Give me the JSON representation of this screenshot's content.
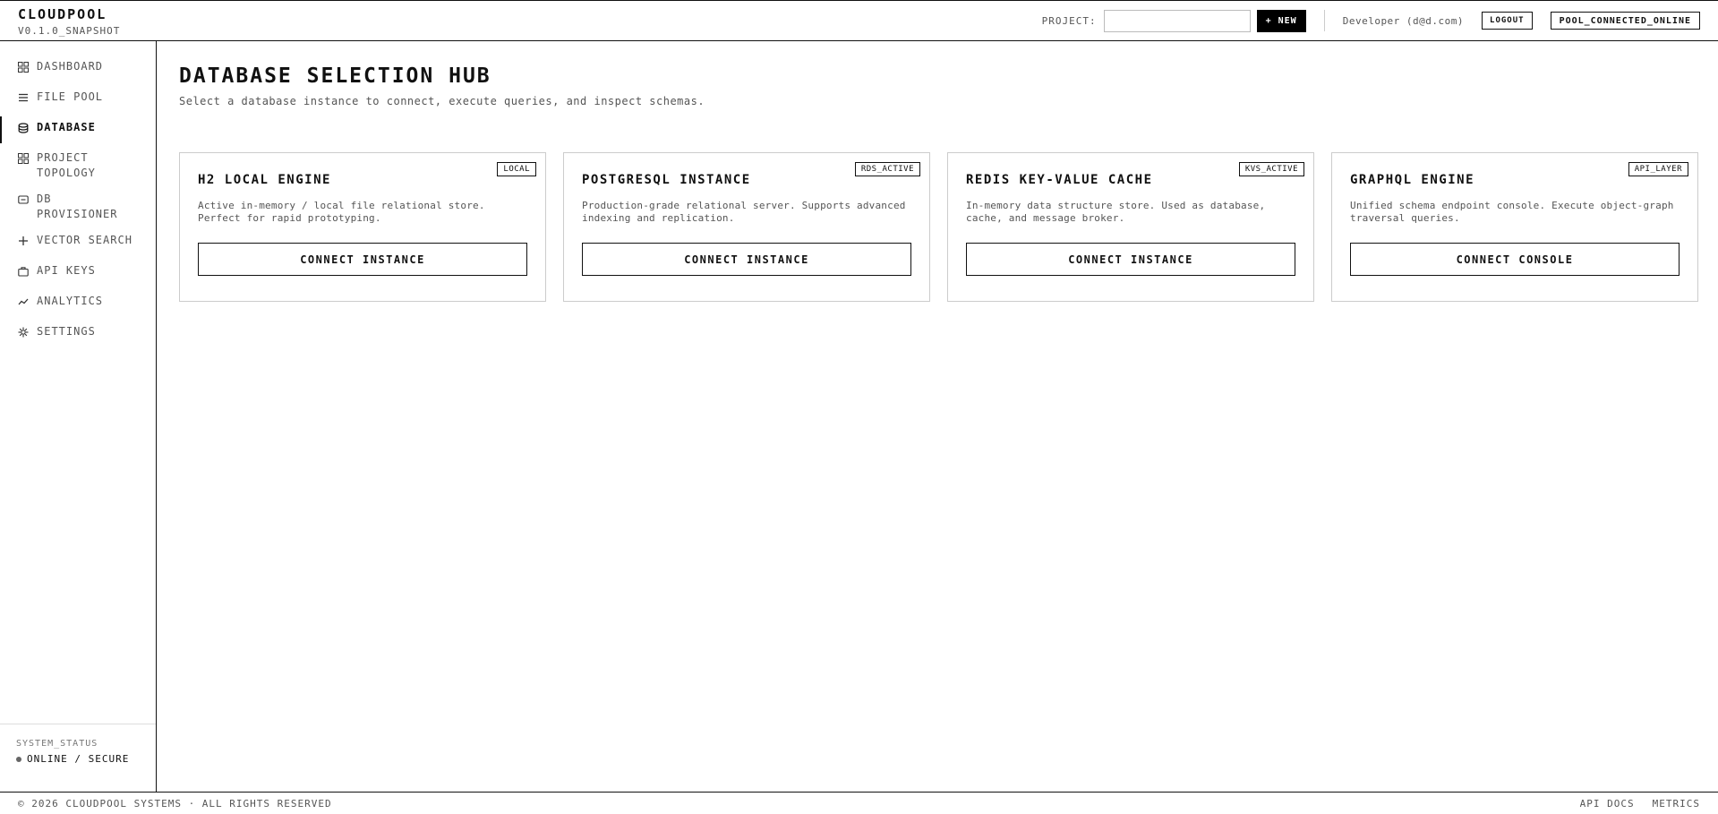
{
  "header": {
    "brand_name": "CLOUDPOOL",
    "brand_version": "V0.1.0_SNAPSHOT",
    "project_label": "PROJECT:",
    "project_value": "",
    "new_button": "+ NEW",
    "user": "Developer (d@d.com)",
    "logout": "LOGOUT",
    "connection_status": "POOL_CONNECTED_ONLINE"
  },
  "sidebar": {
    "items": [
      {
        "label": "DASHBOARD",
        "icon": "grid-icon"
      },
      {
        "label": "FILE POOL",
        "icon": "list-icon"
      },
      {
        "label": "DATABASE",
        "icon": "database-icon",
        "active": true
      },
      {
        "label": "PROJECT TOPOLOGY",
        "icon": "topology-icon"
      },
      {
        "label": "DB PROVISIONER",
        "icon": "server-icon"
      },
      {
        "label": "VECTOR SEARCH",
        "icon": "sparkle-icon"
      },
      {
        "label": "API KEYS",
        "icon": "briefcase-icon"
      },
      {
        "label": "ANALYTICS",
        "icon": "trend-icon"
      },
      {
        "label": "SETTINGS",
        "icon": "gear-icon"
      }
    ],
    "system_status_label": "SYSTEM_STATUS",
    "system_status_value": "ONLINE / SECURE"
  },
  "main": {
    "title": "DATABASE SELECTION HUB",
    "subtitle": "Select a database instance to connect, execute queries, and inspect schemas.",
    "cards": [
      {
        "badge": "LOCAL",
        "title": "H2 LOCAL ENGINE",
        "description": "Active in-memory / local file relational store. Perfect for rapid prototyping.",
        "button": "CONNECT INSTANCE"
      },
      {
        "badge": "RDS_ACTIVE",
        "title": "POSTGRESQL INSTANCE",
        "description": "Production-grade relational server. Supports advanced indexing and replication.",
        "button": "CONNECT INSTANCE"
      },
      {
        "badge": "KVS_ACTIVE",
        "title": "REDIS KEY-VALUE CACHE",
        "description": "In-memory data structure store. Used as database, cache, and message broker.",
        "button": "CONNECT INSTANCE"
      },
      {
        "badge": "API_LAYER",
        "title": "GRAPHQL ENGINE",
        "description": "Unified schema endpoint console. Execute object-graph traversal queries.",
        "button": "CONNECT CONSOLE"
      }
    ]
  },
  "footer": {
    "copyright": "© 2026 CLOUDPOOL SYSTEMS · ALL RIGHTS RESERVED",
    "links": [
      "API DOCS",
      "METRICS"
    ]
  },
  "colors": {
    "text": "#111111",
    "muted": "#555555",
    "border": "#cccccc",
    "accent": "#000000"
  }
}
